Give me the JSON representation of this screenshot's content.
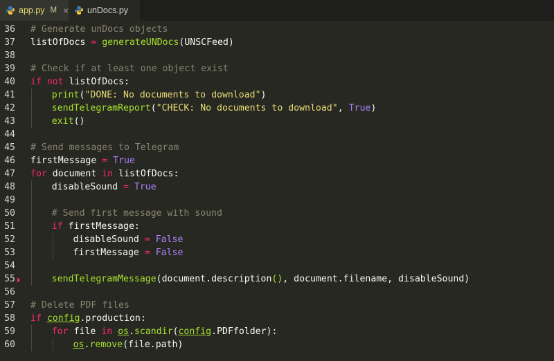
{
  "tabs": [
    {
      "label": "app.py",
      "modified": "M",
      "close": "×"
    },
    {
      "label": "unDocs.py"
    }
  ],
  "colors": {
    "background": "#272822",
    "comment": "#88846f",
    "keyword": "#f92672",
    "function": "#a6e22e",
    "string": "#e6db74",
    "constant": "#ae81ff",
    "text": "#f8f8f2"
  },
  "lines": [
    {
      "n": "36",
      "indent": 0,
      "tokens": [
        {
          "t": "# Generate unDocs objects",
          "c": "cmt"
        }
      ]
    },
    {
      "n": "37",
      "indent": 0,
      "tokens": [
        {
          "t": "listOfDocs ",
          "c": "var"
        },
        {
          "t": "=",
          "c": "op"
        },
        {
          "t": " ",
          "c": "var"
        },
        {
          "t": "generateUNDocs",
          "c": "fn"
        },
        {
          "t": "(UNSCFeed)",
          "c": "var"
        }
      ]
    },
    {
      "n": "38",
      "indent": 0,
      "tokens": []
    },
    {
      "n": "39",
      "indent": 0,
      "tokens": [
        {
          "t": "# Check if at least one object exist",
          "c": "cmt"
        }
      ]
    },
    {
      "n": "40",
      "indent": 0,
      "tokens": [
        {
          "t": "if",
          "c": "kw"
        },
        {
          "t": " ",
          "c": "var"
        },
        {
          "t": "not",
          "c": "kw"
        },
        {
          "t": " listOfDocs:",
          "c": "var"
        }
      ]
    },
    {
      "n": "41",
      "indent": 1,
      "tokens": [
        {
          "t": "print",
          "c": "fn"
        },
        {
          "t": "(",
          "c": "var"
        },
        {
          "t": "\"DONE: No documents to download\"",
          "c": "str"
        },
        {
          "t": ")",
          "c": "var"
        }
      ]
    },
    {
      "n": "42",
      "indent": 1,
      "tokens": [
        {
          "t": "sendTelegramReport",
          "c": "fn"
        },
        {
          "t": "(",
          "c": "var"
        },
        {
          "t": "\"CHECK: No documents to download\"",
          "c": "str"
        },
        {
          "t": ", ",
          "c": "var"
        },
        {
          "t": "True",
          "c": "bool"
        },
        {
          "t": ")",
          "c": "var"
        }
      ]
    },
    {
      "n": "43",
      "indent": 1,
      "tokens": [
        {
          "t": "exit",
          "c": "fn"
        },
        {
          "t": "()",
          "c": "var"
        }
      ]
    },
    {
      "n": "44",
      "indent": 0,
      "tokens": []
    },
    {
      "n": "45",
      "indent": 0,
      "tokens": [
        {
          "t": "# Send messages to Telegram",
          "c": "cmt"
        }
      ]
    },
    {
      "n": "46",
      "indent": 0,
      "tokens": [
        {
          "t": "firstMessage ",
          "c": "var"
        },
        {
          "t": "=",
          "c": "op"
        },
        {
          "t": " ",
          "c": "var"
        },
        {
          "t": "True",
          "c": "bool"
        }
      ]
    },
    {
      "n": "47",
      "indent": 0,
      "tokens": [
        {
          "t": "for",
          "c": "kw"
        },
        {
          "t": " document ",
          "c": "var"
        },
        {
          "t": "in",
          "c": "kw"
        },
        {
          "t": " listOfDocs:",
          "c": "var"
        }
      ]
    },
    {
      "n": "48",
      "indent": 1,
      "tokens": [
        {
          "t": "disableSound ",
          "c": "var"
        },
        {
          "t": "=",
          "c": "op"
        },
        {
          "t": " ",
          "c": "var"
        },
        {
          "t": "True",
          "c": "bool"
        }
      ]
    },
    {
      "n": "49",
      "indent": 1,
      "tokens": []
    },
    {
      "n": "50",
      "indent": 1,
      "tokens": [
        {
          "t": "# Send first message with sound",
          "c": "cmt"
        }
      ]
    },
    {
      "n": "51",
      "indent": 1,
      "tokens": [
        {
          "t": "if",
          "c": "kw"
        },
        {
          "t": " firstMessage:",
          "c": "var"
        }
      ]
    },
    {
      "n": "52",
      "indent": 2,
      "tokens": [
        {
          "t": "disableSound ",
          "c": "var"
        },
        {
          "t": "=",
          "c": "op"
        },
        {
          "t": " ",
          "c": "var"
        },
        {
          "t": "False",
          "c": "bool"
        }
      ]
    },
    {
      "n": "53",
      "indent": 2,
      "tokens": [
        {
          "t": "firstMessage ",
          "c": "var"
        },
        {
          "t": "=",
          "c": "op"
        },
        {
          "t": " ",
          "c": "var"
        },
        {
          "t": "False",
          "c": "bool"
        }
      ]
    },
    {
      "n": "54",
      "indent": 1,
      "tokens": []
    },
    {
      "n": "55",
      "indent": 1,
      "marker": true,
      "tokens": [
        {
          "t": "sendTelegramMessage",
          "c": "fn"
        },
        {
          "t": "(document.",
          "c": "var"
        },
        {
          "t": "description",
          "c": "var"
        },
        {
          "t": "()",
          "c": "fn"
        },
        {
          "t": ", document.filename, disableSound)",
          "c": "var"
        }
      ]
    },
    {
      "n": "56",
      "indent": 0,
      "tokens": []
    },
    {
      "n": "57",
      "indent": 0,
      "tokens": [
        {
          "t": "# Delete PDF files",
          "c": "cmt"
        }
      ]
    },
    {
      "n": "58",
      "indent": 0,
      "tokens": [
        {
          "t": "if",
          "c": "kw"
        },
        {
          "t": " ",
          "c": "var"
        },
        {
          "t": "config",
          "c": "mod"
        },
        {
          "t": ".production:",
          "c": "var"
        }
      ]
    },
    {
      "n": "59",
      "indent": 1,
      "tokens": [
        {
          "t": "for",
          "c": "kw"
        },
        {
          "t": " file ",
          "c": "var"
        },
        {
          "t": "in",
          "c": "kw"
        },
        {
          "t": " ",
          "c": "var"
        },
        {
          "t": "os",
          "c": "mod"
        },
        {
          "t": ".",
          "c": "var"
        },
        {
          "t": "scandir",
          "c": "fn"
        },
        {
          "t": "(",
          "c": "var"
        },
        {
          "t": "config",
          "c": "mod"
        },
        {
          "t": ".PDFfolder):",
          "c": "var"
        }
      ]
    },
    {
      "n": "60",
      "indent": 2,
      "tokens": [
        {
          "t": "os",
          "c": "mod"
        },
        {
          "t": ".",
          "c": "var"
        },
        {
          "t": "remove",
          "c": "fn"
        },
        {
          "t": "(file.path)",
          "c": "var"
        }
      ]
    }
  ]
}
